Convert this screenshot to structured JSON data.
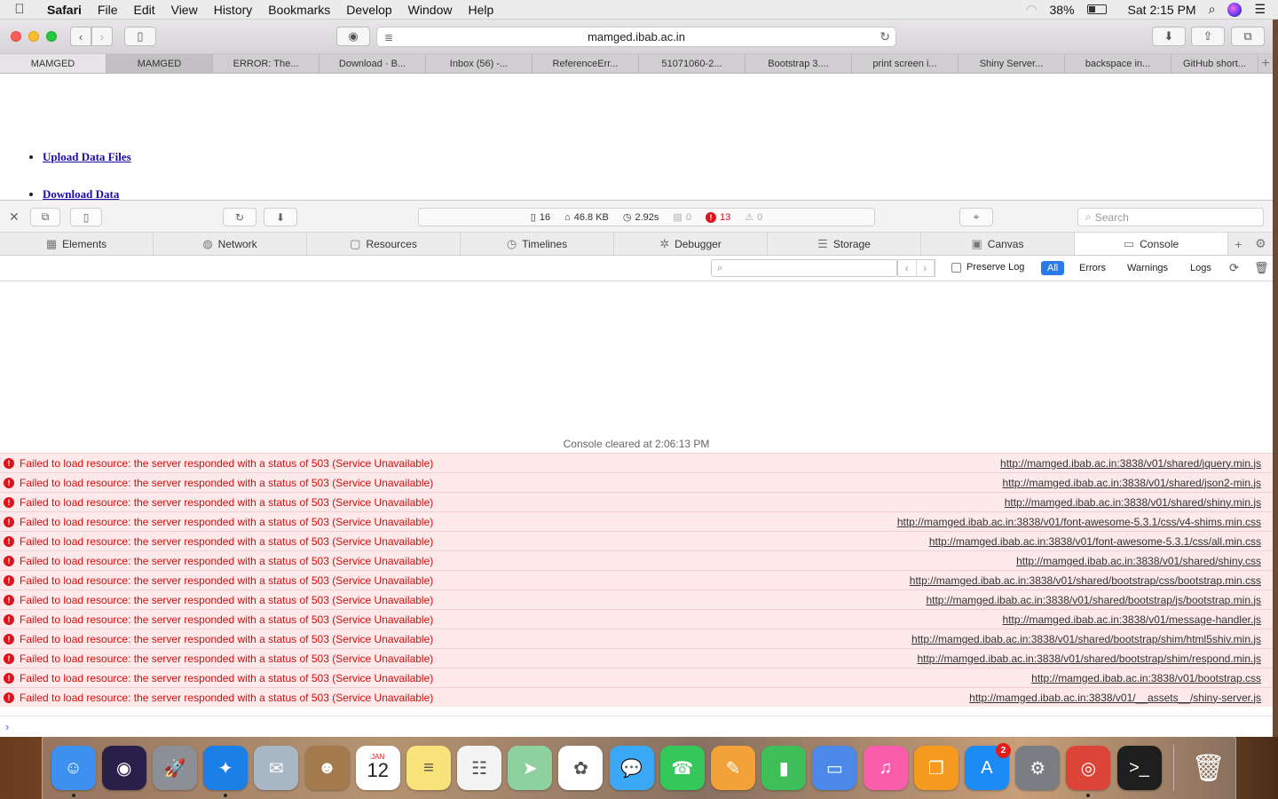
{
  "menubar": {
    "app": "Safari",
    "items": [
      "File",
      "Edit",
      "View",
      "History",
      "Bookmarks",
      "Develop",
      "Window",
      "Help"
    ],
    "battery": "38%",
    "clock": "Sat 2:15 PM"
  },
  "browser": {
    "url": "mamged.ibab.ac.in",
    "tabs": [
      "MAMGED",
      "MAMGED",
      "ERROR: The...",
      "Download · B...",
      "Inbox (56) -...",
      "ReferenceErr...",
      "51071060-2...",
      "Bootstrap 3....",
      "print screen i...",
      "Shiny Server...",
      "backspace in...",
      "GitHub short..."
    ]
  },
  "page": {
    "links": [
      "Upload Data Files",
      "Download Data"
    ]
  },
  "inspector": {
    "stats": {
      "resources": "16",
      "size": "46.8 KB",
      "time": "2.92s",
      "logs": "0",
      "errors": "13",
      "warnings": "0"
    },
    "search_placeholder": "Search",
    "tabs": [
      {
        "label": "Elements",
        "icon": "▦"
      },
      {
        "label": "Network",
        "icon": "◍"
      },
      {
        "label": "Resources",
        "icon": "▢"
      },
      {
        "label": "Timelines",
        "icon": "◷"
      },
      {
        "label": "Debugger",
        "icon": "✲"
      },
      {
        "label": "Storage",
        "icon": "☰"
      },
      {
        "label": "Canvas",
        "icon": "▣"
      },
      {
        "label": "Console",
        "icon": "▭"
      }
    ]
  },
  "console": {
    "preserve_log": "Preserve Log",
    "levels": [
      "All",
      "Errors",
      "Warnings",
      "Logs"
    ],
    "cleared": "Console cleared at 2:06:13 PM",
    "message": "Failed to load resource: the server responded with a status of 503 (Service Unavailable)",
    "sources": [
      "http://mamged.ibab.ac.in:3838/v01/shared/jquery.min.js",
      "http://mamged.ibab.ac.in:3838/v01/shared/json2-min.js",
      "http://mamged.ibab.ac.in:3838/v01/shared/shiny.min.js",
      "http://mamged.ibab.ac.in:3838/v01/font-awesome-5.3.1/css/v4-shims.min.css",
      "http://mamged.ibab.ac.in:3838/v01/font-awesome-5.3.1/css/all.min.css",
      "http://mamged.ibab.ac.in:3838/v01/shared/shiny.css",
      "http://mamged.ibab.ac.in:3838/v01/shared/bootstrap/css/bootstrap.min.css",
      "http://mamged.ibab.ac.in:3838/v01/shared/bootstrap/js/bootstrap.min.js",
      "http://mamged.ibab.ac.in:3838/v01/message-handler.js",
      "http://mamged.ibab.ac.in:3838/v01/shared/bootstrap/shim/html5shiv.min.js",
      "http://mamged.ibab.ac.in:3838/v01/shared/bootstrap/shim/respond.min.js",
      "http://mamged.ibab.ac.in:3838/v01/bootstrap.css",
      "http://mamged.ibab.ac.in:3838/v01/__assets__/shiny-server.js"
    ]
  },
  "calendar": {
    "month": "JAN",
    "day": "12"
  },
  "dock": {
    "appstore_badge": "2",
    "apps": [
      {
        "name": "finder-icon",
        "color": "#3d8ff0",
        "glyph": "☺"
      },
      {
        "name": "siri-icon",
        "color": "#2a1f4a",
        "glyph": "◉"
      },
      {
        "name": "launchpad-icon",
        "color": "#8c8f96",
        "glyph": "🚀"
      },
      {
        "name": "safari-icon",
        "color": "#1a7fe6",
        "glyph": "✦"
      },
      {
        "name": "mail-eagle-icon",
        "color": "#a9b7c4",
        "glyph": "✉"
      },
      {
        "name": "contacts-icon",
        "color": "#a27a4d",
        "glyph": "☻"
      },
      {
        "name": "calendar-icon",
        "color": "#ffffff",
        "glyph": ""
      },
      {
        "name": "notes-icon",
        "color": "#f8e27a",
        "glyph": "≡"
      },
      {
        "name": "reminders-icon",
        "color": "#f4f4f4",
        "glyph": "☷"
      },
      {
        "name": "maps-icon",
        "color": "#8fd19e",
        "glyph": "➤"
      },
      {
        "name": "photos-icon",
        "color": "#ffffff",
        "glyph": "✿"
      },
      {
        "name": "messages-icon",
        "color": "#3aa8f5",
        "glyph": "💬"
      },
      {
        "name": "facetime-icon",
        "color": "#35c759",
        "glyph": "☎"
      },
      {
        "name": "pages-icon",
        "color": "#f3a23a",
        "glyph": "✎"
      },
      {
        "name": "numbers-icon",
        "color": "#3fbf5a",
        "glyph": "▮"
      },
      {
        "name": "keynote-icon",
        "color": "#4b88e8",
        "glyph": "▭"
      },
      {
        "name": "itunes-icon",
        "color": "#f95dab",
        "glyph": "♫"
      },
      {
        "name": "books-icon",
        "color": "#f59a1e",
        "glyph": "❐"
      },
      {
        "name": "app-store-icon",
        "color": "#1c8cf4",
        "glyph": "A"
      },
      {
        "name": "system-preferences-icon",
        "color": "#7a7d82",
        "glyph": "⚙"
      },
      {
        "name": "chrome-icon",
        "color": "#db4437",
        "glyph": "◎"
      },
      {
        "name": "terminal-icon",
        "color": "#1e1e1e",
        "glyph": ">_"
      }
    ]
  },
  "trash_glyph": "🗑"
}
